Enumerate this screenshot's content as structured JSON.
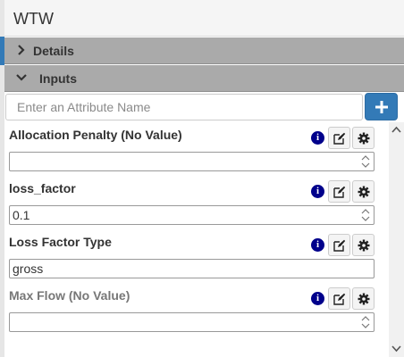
{
  "panel": {
    "title": "WTW",
    "sections": {
      "details_label": "Details",
      "inputs_label": "Inputs"
    },
    "search": {
      "placeholder": "Enter an Attribute Name"
    },
    "add_button_icon": "plus-icon"
  },
  "attributes": [
    {
      "name": "Allocation Penalty (No Value)",
      "value": "",
      "has_spinner": true,
      "muted": false
    },
    {
      "name": "loss_factor",
      "value": "0.1",
      "has_spinner": true,
      "muted": false
    },
    {
      "name": "Loss Factor Type",
      "value": "gross",
      "has_spinner": false,
      "muted": false
    },
    {
      "name": "Max Flow (No Value)",
      "value": "",
      "has_spinner": true,
      "muted": true
    }
  ],
  "icons": {
    "info": "i",
    "edit": "edit-icon",
    "settings": "gear-icon"
  },
  "colors": {
    "accent": "#337ab7",
    "section_bg": "#aaaaaa",
    "info": "#00008b"
  }
}
